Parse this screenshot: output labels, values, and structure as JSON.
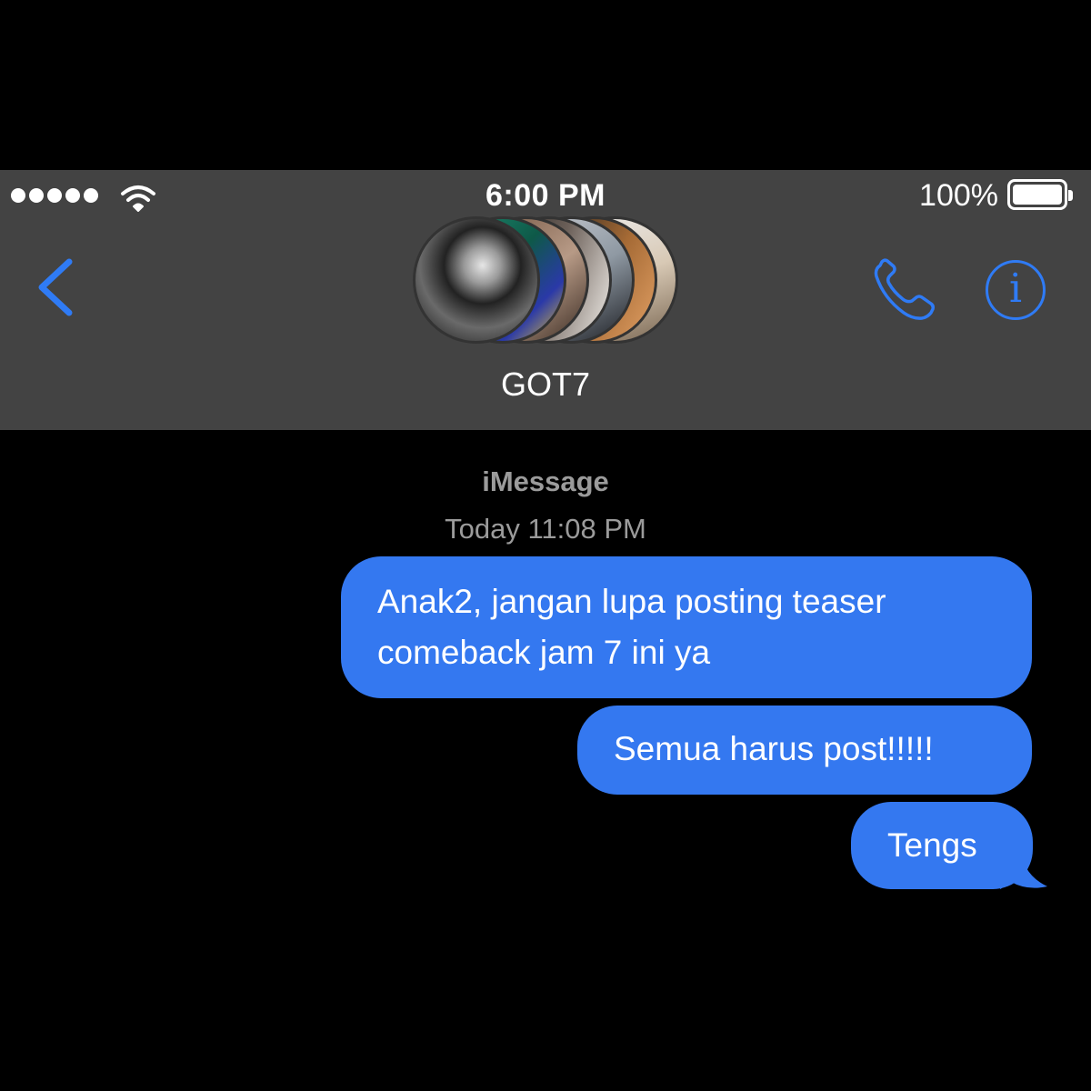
{
  "status_bar": {
    "time": "6:00 PM",
    "battery_percent": "100%",
    "battery_level": 1.0,
    "signal_dots": 5,
    "icons": [
      "signal-dots-icon",
      "wifi-icon",
      "battery-icon"
    ]
  },
  "nav": {
    "back_icon": "chevron-left-icon",
    "group_name": "GOT7",
    "call_icon": "phone-icon",
    "info_icon": "info-icon",
    "info_glyph": "i",
    "avatar_count": 7
  },
  "conversation": {
    "service_label": "iMessage",
    "timestamp": "Today 11:08 PM",
    "messages": [
      {
        "line1": "Anak2, jangan lupa posting teaser",
        "line2": "comeback jam 7 ini ya",
        "sent": true
      },
      {
        "text": "Semua harus post!!!!!",
        "sent": true
      },
      {
        "text": "Tengs",
        "sent": true
      }
    ]
  },
  "colors": {
    "accent": "#2f7bf5",
    "bubble": "#3478f0",
    "header_bg": "#434343",
    "background": "#000000",
    "meta_text": "#9b9b9b"
  }
}
